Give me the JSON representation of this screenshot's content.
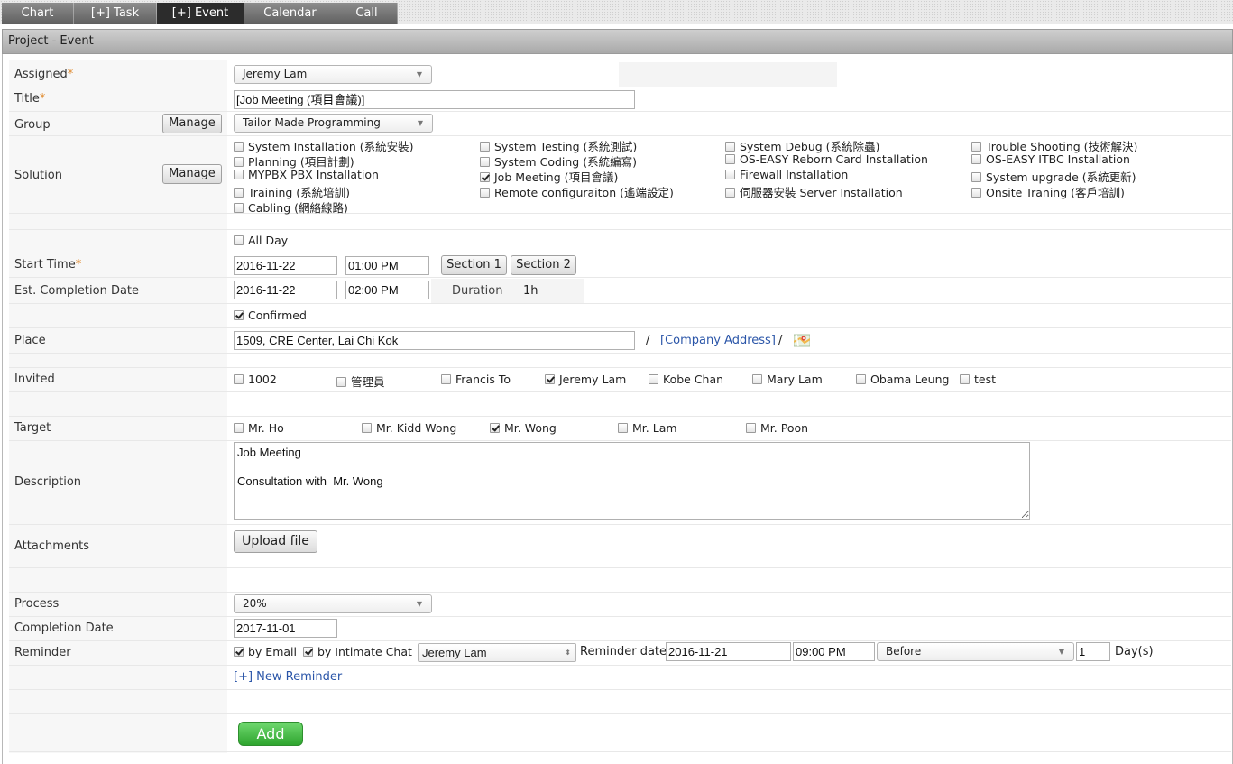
{
  "tabs": [
    {
      "label": "Chart"
    },
    {
      "label": "[+] Task"
    },
    {
      "label": "[+] Event"
    },
    {
      "label": "Calendar"
    },
    {
      "label": "Call"
    }
  ],
  "panel_title": "Project - Event",
  "fields": {
    "assigned_label": "Assigned",
    "assigned_value": "Jeremy Lam",
    "title_label": "Title",
    "title_value": "[Job Meeting (項目會議)]",
    "group_label": "Group",
    "group_value": "Tailor Made Programming",
    "manage_label": "Manage",
    "solution_label": "Solution",
    "all_day_label": "All Day",
    "start_time_label": "Start Time",
    "start_date": "2016-11-22",
    "start_time": "01:00 PM",
    "section1": "Section 1",
    "section2": "Section 2",
    "est_completion_label": "Est. Completion Date",
    "est_date": "2016-11-22",
    "est_time": "02:00 PM",
    "duration_label": "Duration",
    "duration_value": "1h",
    "confirmed_label": "Confirmed",
    "place_label": "Place",
    "place_value": "1509, CRE Center, Lai Chi Kok",
    "slash1": "/",
    "company_address": "[Company Address]",
    "slash2": "/",
    "invited_label": "Invited",
    "target_label": "Target",
    "description_label": "Description",
    "description_value": "Job Meeting\n\nConsultation with  Mr. Wong",
    "attachments_label": "Attachments",
    "upload_label": "Upload file",
    "process_label": "Process",
    "process_value": "20%",
    "completion_date_label": "Completion Date",
    "completion_date_value": "2017-11-01",
    "reminder_label": "Reminder",
    "by_email": "by Email",
    "by_chat": "by Intimate Chat",
    "reminder_user": "Jeremy Lam",
    "reminder_date_label": "Reminder date",
    "reminder_date": "2016-11-21",
    "reminder_time": "09:00 PM",
    "reminder_when": "Before",
    "reminder_days": "1",
    "days_unit": "Day(s)",
    "new_reminder": "[+] New Reminder",
    "add_label": "Add",
    "required_mark": "*"
  },
  "solutions": [
    {
      "label": "System Installation (系統安裝)",
      "checked": false
    },
    {
      "label": "System Testing (系統測試)",
      "checked": false
    },
    {
      "label": "System Debug (系統除蟲)",
      "checked": false
    },
    {
      "label": "Trouble Shooting (技術解決)",
      "checked": false
    },
    {
      "label": "Planning (項目計劃)",
      "checked": false
    },
    {
      "label": "System Coding (系統編寫)",
      "checked": false
    },
    {
      "label": "OS-EASY Reborn Card Installation",
      "checked": false
    },
    {
      "label": "OS-EASY ITBC Installation",
      "checked": false
    },
    {
      "label": "MYPBX PBX Installation",
      "checked": false
    },
    {
      "label": "Job Meeting (項目會議)",
      "checked": true
    },
    {
      "label": "Firewall Installation",
      "checked": false
    },
    {
      "label": "System upgrade (系統更新)",
      "checked": false
    },
    {
      "label": "Training (系統培訓)",
      "checked": false
    },
    {
      "label": "Remote configuraiton (遙端設定)",
      "checked": false
    },
    {
      "label": "伺服器安裝 Server Installation",
      "checked": false
    },
    {
      "label": "Onsite Traning (客戶培訓)",
      "checked": false
    },
    {
      "label": "Cabling (網絡線路)",
      "checked": false
    }
  ],
  "invited": [
    {
      "label": "1002",
      "checked": false
    },
    {
      "label": "管理員",
      "checked": false
    },
    {
      "label": "Francis To",
      "checked": false
    },
    {
      "label": "Jeremy Lam",
      "checked": true
    },
    {
      "label": "Kobe Chan",
      "checked": false
    },
    {
      "label": "Mary Lam",
      "checked": false
    },
    {
      "label": "Obama Leung",
      "checked": false
    },
    {
      "label": "test",
      "checked": false
    }
  ],
  "targets": [
    {
      "label": "Mr. Ho",
      "checked": false
    },
    {
      "label": "Mr. Kidd Wong",
      "checked": false
    },
    {
      "label": "Mr. Wong",
      "checked": true
    },
    {
      "label": "Mr. Lam",
      "checked": false
    },
    {
      "label": "Mr. Poon",
      "checked": false
    }
  ],
  "options": {
    "all_day": false,
    "confirmed": true,
    "by_email": true,
    "by_chat": true
  }
}
